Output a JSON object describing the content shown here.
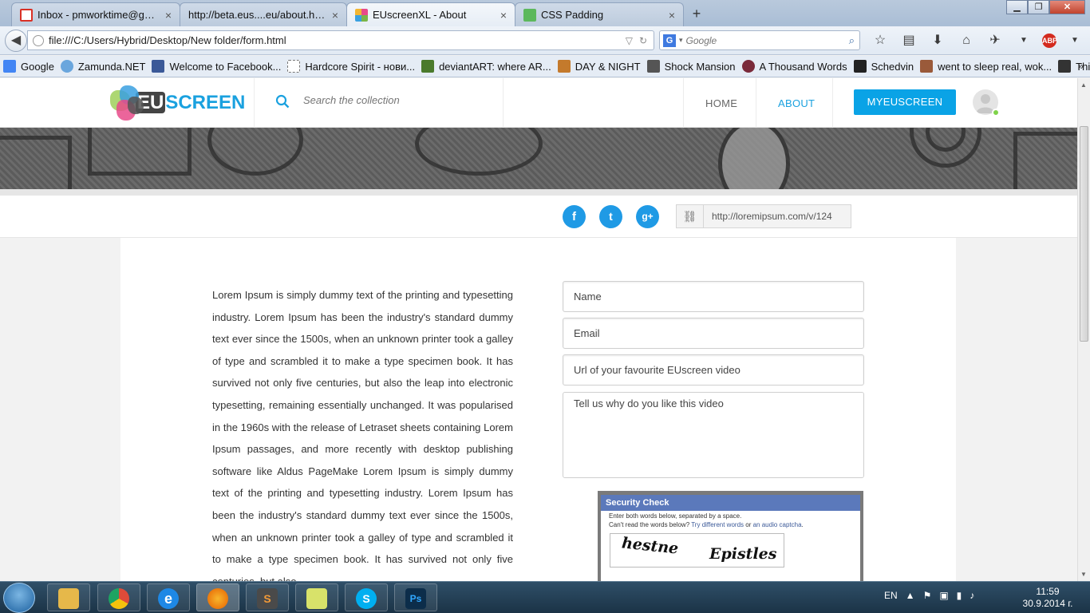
{
  "browser": {
    "tabs": [
      {
        "title": "Inbox - pmworktime@gma...",
        "icon_color": "#d93025",
        "icon": "gmail-icon"
      },
      {
        "title": "http://beta.eus....eu/about.html",
        "icon_color": "#cccccc",
        "icon": "blank-page-icon"
      },
      {
        "title": "EUscreenXL - About",
        "icon_color": "#7ab648",
        "icon": "euscreen-favicon",
        "active": true
      },
      {
        "title": "CSS Padding",
        "icon_color": "#5cb85c",
        "icon": "w3schools-icon"
      }
    ],
    "close_glyph": "×",
    "newtab_glyph": "+",
    "url": "file:///C:/Users/Hybrid/Desktop/New folder/form.html",
    "search_engine": "G",
    "search_placeholder": "Google",
    "bookmarks": [
      {
        "label": "Google",
        "icon_color": "#e9edf4"
      },
      {
        "label": "Zamunda.NET",
        "icon_color": "#6aa6dd"
      },
      {
        "label": "Welcome to Facebook...",
        "icon_color": "#3b5998"
      },
      {
        "label": "Hardcore Spirit - нови...",
        "icon_color": "#ffffff"
      },
      {
        "label": "deviantART: where AR...",
        "icon_color": "#4a7a2c"
      },
      {
        "label": "DAY & NIGHT",
        "icon_color": "#c47a2c"
      },
      {
        "label": "Shock Mansion",
        "icon_color": "#555555"
      },
      {
        "label": "A Thousand Words",
        "icon_color": "#7a2a3a"
      },
      {
        "label": "Schedvin",
        "icon_color": "#222222"
      },
      {
        "label": "went to sleep real, wok...",
        "icon_color": "#9a5a3a"
      },
      {
        "label": "Things of that nature",
        "icon_color": "#333333"
      }
    ],
    "bookmarks_overflow": "»"
  },
  "site": {
    "logo_eu": "EU",
    "logo_screen": "SCREEN",
    "search_placeholder": "Search the collection",
    "nav": {
      "home": "HOME",
      "about": "ABOUT"
    },
    "my_button": "MYEUSCREEN",
    "share": {
      "facebook": "f",
      "twitter": "t",
      "googleplus": "g+",
      "link_url": "http://loremipsum.com/v/124"
    },
    "colors": {
      "accent": "#1aa1df",
      "button": "#0aa3e6",
      "online": "#7fd34a"
    }
  },
  "main": {
    "body_text": "Lorem Ipsum is simply dummy text of the printing and typesetting industry. Lorem Ipsum has been the industry's standard dummy text ever since the 1500s, when an unknown printer took a galley of type and scrambled it to make a type specimen book. It has survived not only five centuries, but also the leap into electronic typesetting, remaining essentially unchanged. It was popularised in the 1960s with the release of Letraset sheets containing Lorem Ipsum passages, and more recently with desktop publishing software like Aldus PageMake Lorem Ipsum is simply dummy text of the printing and typesetting industry. Lorem Ipsum has been the industry's standard dummy text ever since the 1500s, when an unknown printer took a galley of type and scrambled it to make a type specimen book. It has survived not only five centuries, but also",
    "form": {
      "name_placeholder": "Name",
      "email_placeholder": "Email",
      "url_placeholder": "Url of your favourite EUscreen video",
      "reason_placeholder": "Tell us why do you like this video"
    },
    "captcha": {
      "title": "Security Check",
      "line1": "Enter both words below, separated by a space.",
      "line2_prefix": "Can't read the words below? ",
      "link1": "Try different words",
      "or": " or ",
      "link2": "an audio captcha",
      "period": ".",
      "word1": "hestne",
      "word2": "Epistles"
    }
  },
  "taskbar": {
    "apps": [
      {
        "name": "explorer-icon",
        "color": "#e6b84a",
        "label": ""
      },
      {
        "name": "chrome-icon",
        "color": "#dd4b39",
        "label": ""
      },
      {
        "name": "ie-icon",
        "color": "#1e88e5",
        "label": "e"
      },
      {
        "name": "firefox-icon",
        "color": "#e66000",
        "label": ""
      },
      {
        "name": "sublime-icon",
        "color": "#4a4a4a",
        "label": "S"
      },
      {
        "name": "sticky-notes-icon",
        "color": "#d8e26a",
        "label": ""
      },
      {
        "name": "skype-icon",
        "color": "#00aff0",
        "label": "S"
      },
      {
        "name": "photoshop-icon",
        "color": "#0c2d4a",
        "label": "Ps"
      }
    ],
    "lang": "EN",
    "time": "11:59",
    "date": "30.9.2014 г."
  }
}
